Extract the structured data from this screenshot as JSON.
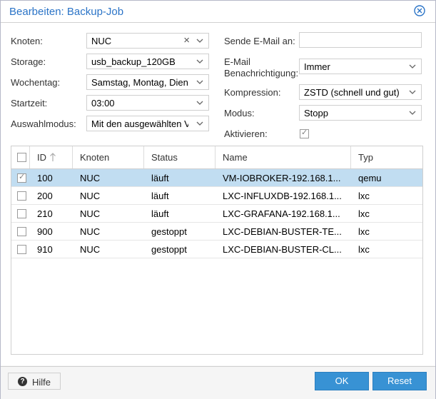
{
  "dialog": {
    "title": "Bearbeiten: Backup-Job"
  },
  "left_form": {
    "knoten": {
      "label": "Knoten:",
      "value": "NUC"
    },
    "storage": {
      "label": "Storage:",
      "value": "usb_backup_120GB"
    },
    "wochentag": {
      "label": "Wochentag:",
      "value": "Samstag, Montag, Dienst"
    },
    "startzeit": {
      "label": "Startzeit:",
      "value": "03:00"
    },
    "auswahlmodus": {
      "label": "Auswahlmodus:",
      "value": "Mit den ausgewählten VMs"
    }
  },
  "right_form": {
    "email": {
      "label": "Sende E-Mail an:",
      "value": ""
    },
    "benachrichtigung": {
      "label_line1": "E-Mail",
      "label_line2": "Benachrichtigung:",
      "value": "Immer"
    },
    "kompression": {
      "label": "Kompression:",
      "value": "ZSTD (schnell und gut)"
    },
    "modus": {
      "label": "Modus:",
      "value": "Stopp"
    },
    "aktivieren": {
      "label": "Aktivieren:",
      "checked": true
    }
  },
  "grid": {
    "columns": {
      "id": "ID",
      "knoten": "Knoten",
      "status": "Status",
      "name": "Name",
      "typ": "Typ"
    },
    "rows": [
      {
        "checked": true,
        "id": "100",
        "knoten": "NUC",
        "status": "läuft",
        "name": "VM-IOBROKER-192.168.1...",
        "typ": "qemu"
      },
      {
        "checked": false,
        "id": "200",
        "knoten": "NUC",
        "status": "läuft",
        "name": "LXC-INFLUXDB-192.168.1...",
        "typ": "lxc"
      },
      {
        "checked": false,
        "id": "210",
        "knoten": "NUC",
        "status": "läuft",
        "name": "LXC-GRAFANA-192.168.1...",
        "typ": "lxc"
      },
      {
        "checked": false,
        "id": "900",
        "knoten": "NUC",
        "status": "gestoppt",
        "name": "LXC-DEBIAN-BUSTER-TE...",
        "typ": "lxc"
      },
      {
        "checked": false,
        "id": "910",
        "knoten": "NUC",
        "status": "gestoppt",
        "name": "LXC-DEBIAN-BUSTER-CL...",
        "typ": "lxc"
      }
    ]
  },
  "footer": {
    "help_label": "Hilfe",
    "ok_label": "OK",
    "reset_label": "Reset"
  },
  "colors": {
    "accent": "#3892d4",
    "title": "#2b74c7",
    "selected_row": "#c1ddf1"
  }
}
